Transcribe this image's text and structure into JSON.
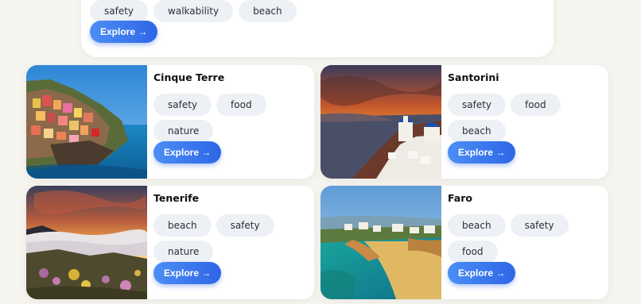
{
  "top_card": {
    "tags": [
      "safety",
      "walkability",
      "beach"
    ],
    "explore_label": "Explore →"
  },
  "cards": [
    {
      "title": "Cinque Terre",
      "tags": [
        "safety",
        "food",
        "nature"
      ],
      "explore_label": "Explore →"
    },
    {
      "title": "Santorini",
      "tags": [
        "safety",
        "food",
        "beach"
      ],
      "explore_label": "Explore →"
    },
    {
      "title": "Tenerife",
      "tags": [
        "beach",
        "safety",
        "nature"
      ],
      "explore_label": "Explore →"
    },
    {
      "title": "Faro",
      "tags": [
        "beach",
        "safety",
        "food"
      ],
      "explore_label": "Explore →"
    }
  ]
}
